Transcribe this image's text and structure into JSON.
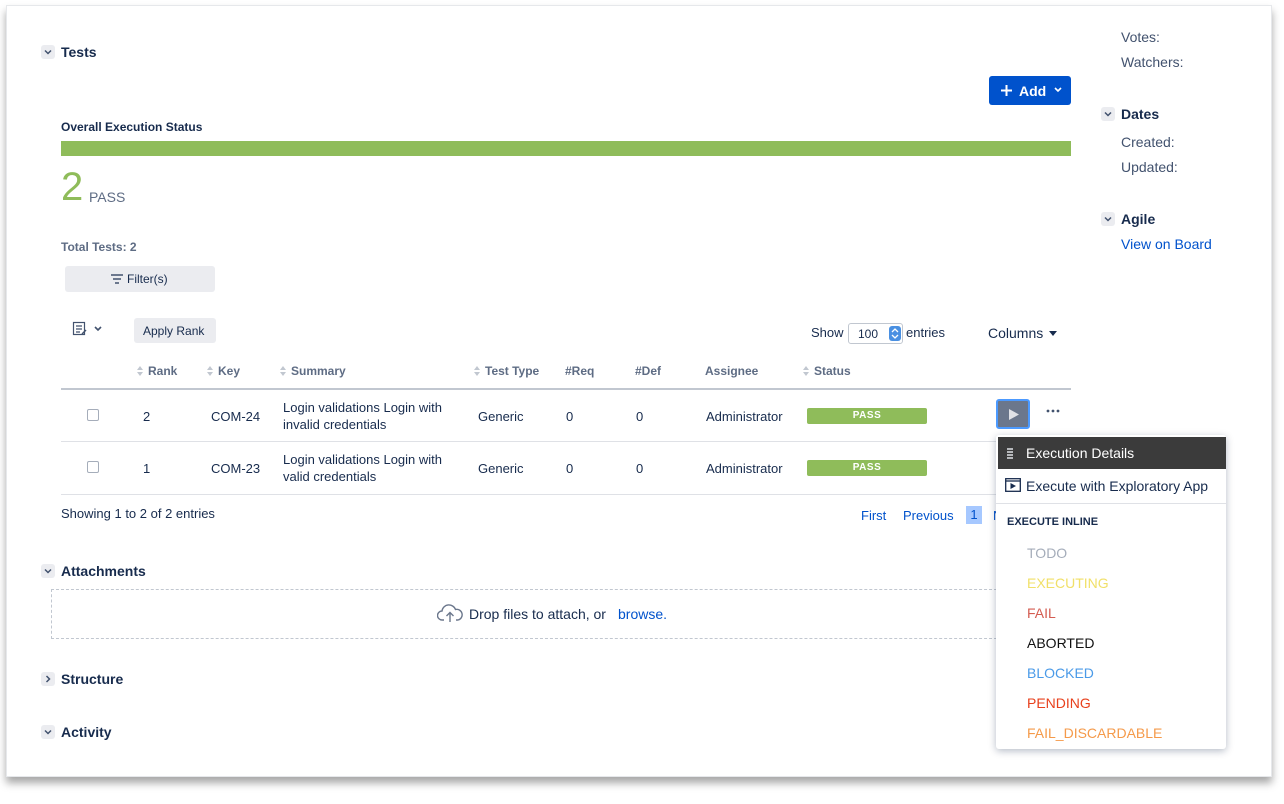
{
  "tests_section": {
    "title": "Tests",
    "add_button_label": "Add",
    "overall_status_label": "Overall Execution Status",
    "pass_count": "2",
    "pass_label": "PASS",
    "pass_fraction": 1.0,
    "total_tests_label": "Total Tests: 2",
    "filter_label": "Filter(s)",
    "apply_rank_label": "Apply Rank",
    "show_label": "Show",
    "entries_value": "100",
    "entries_label": "entries",
    "columns_label": "Columns"
  },
  "table": {
    "headers": {
      "rank": "Rank",
      "key": "Key",
      "summary": "Summary",
      "test_type": "Test Type",
      "req": "#Req",
      "def": "#Def",
      "assignee": "Assignee",
      "status": "Status"
    },
    "rows": [
      {
        "rank": "2",
        "key": "COM-24",
        "summary_line1": "Login validations Login with",
        "summary_line2": "invalid credentials",
        "test_type": "Generic",
        "req": "0",
        "def": "0",
        "assignee": "Administrator",
        "status": "PASS"
      },
      {
        "rank": "1",
        "key": "COM-23",
        "summary_line1": "Login validations Login with",
        "summary_line2": "valid credentials",
        "test_type": "Generic",
        "req": "0",
        "def": "0",
        "assignee": "Administrator",
        "status": "PASS"
      }
    ],
    "showing_label": "Showing 1 to 2 of 2 entries",
    "pagination": {
      "first": "First",
      "previous": "Previous",
      "current_page": "1",
      "next_partial": "N"
    }
  },
  "execute_menu": {
    "execution_details": "Execution Details",
    "exploratory_app": "Execute with Exploratory App",
    "inline_header": "EXECUTE INLINE",
    "statuses": [
      {
        "label": "TODO",
        "color": "#a5adba"
      },
      {
        "label": "EXECUTING",
        "color": "#f1e069"
      },
      {
        "label": "FAIL",
        "color": "#d45d52"
      },
      {
        "label": "ABORTED",
        "color": "#111111"
      },
      {
        "label": "BLOCKED",
        "color": "#4a9ae8"
      },
      {
        "label": "PENDING",
        "color": "#e8401c"
      },
      {
        "label": "FAIL_DISCARDABLE",
        "color": "#f59a4a"
      }
    ]
  },
  "attachments": {
    "title": "Attachments",
    "drop_text": "Drop files to attach, or",
    "browse_link": "browse."
  },
  "structure": {
    "title": "Structure"
  },
  "activity": {
    "title": "Activity"
  },
  "sidebar": {
    "votes_label": "Votes:",
    "watchers_label": "Watchers:",
    "dates_title": "Dates",
    "created_label": "Created:",
    "updated_label": "Updated:",
    "agile_title": "Agile",
    "view_on_board": "View on Board"
  },
  "colors": {
    "pass_green": "#8fbc5a",
    "primary_blue": "#0052cc",
    "menu_dark": "#3b3b3b"
  }
}
